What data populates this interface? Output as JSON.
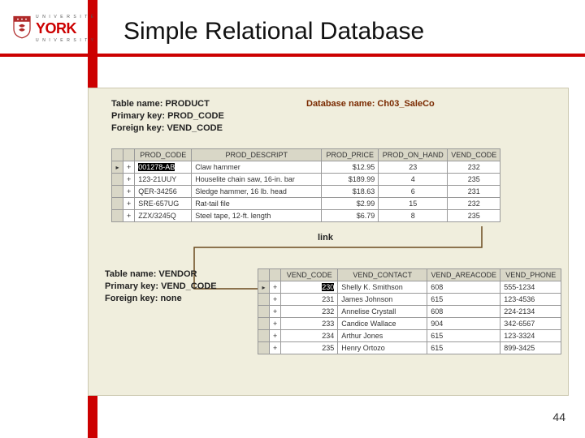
{
  "logo": {
    "universite": "U N I V E R S I T É",
    "york": "YORK",
    "university": "U N I V E R S I T Y"
  },
  "title": "Simple Relational Database",
  "figure": {
    "db_label": "Database name: Ch03_SaleCo",
    "product": {
      "meta": {
        "l1": "Table name: PRODUCT",
        "l2": "Primary key: PROD_CODE",
        "l3": "Foreign key: VEND_CODE"
      },
      "headers": {
        "c0": "PROD_CODE",
        "c1": "PROD_DESCRIPT",
        "c2": "PROD_PRICE",
        "c3": "PROD_ON_HAND",
        "c4": "VEND_CODE"
      },
      "rows": [
        {
          "code": "001278-AB",
          "desc": "Claw hammer",
          "price": "$12.95",
          "onhand": "23",
          "vend": "232"
        },
        {
          "code": "123-21UUY",
          "desc": "Houselite chain saw, 16-in. bar",
          "price": "$189.99",
          "onhand": "4",
          "vend": "235"
        },
        {
          "code": "QER-34256",
          "desc": "Sledge hammer, 16 lb. head",
          "price": "$18.63",
          "onhand": "6",
          "vend": "231"
        },
        {
          "code": "SRE-657UG",
          "desc": "Rat-tail file",
          "price": "$2.99",
          "onhand": "15",
          "vend": "232"
        },
        {
          "code": "ZZX/3245Q",
          "desc": "Steel tape, 12-ft. length",
          "price": "$6.79",
          "onhand": "8",
          "vend": "235"
        }
      ]
    },
    "link_label": "link",
    "vendor": {
      "meta": {
        "l1": "Table name: VENDOR",
        "l2": "Primary key: VEND_CODE",
        "l3": "Foreign key: none"
      },
      "headers": {
        "c0": "VEND_CODE",
        "c1": "VEND_CONTACT",
        "c2": "VEND_AREACODE",
        "c3": "VEND_PHONE"
      },
      "rows": [
        {
          "code": "230",
          "contact": "Shelly K. Smithson",
          "area": "608",
          "phone": "555-1234"
        },
        {
          "code": "231",
          "contact": "James Johnson",
          "area": "615",
          "phone": "123-4536"
        },
        {
          "code": "232",
          "contact": "Annelise Crystall",
          "area": "608",
          "phone": "224-2134"
        },
        {
          "code": "233",
          "contact": "Candice Wallace",
          "area": "904",
          "phone": "342-6567"
        },
        {
          "code": "234",
          "contact": "Arthur Jones",
          "area": "615",
          "phone": "123-3324"
        },
        {
          "code": "235",
          "contact": "Henry Ortozo",
          "area": "615",
          "phone": "899-3425"
        }
      ]
    }
  },
  "page_number": "44",
  "chart_data": {
    "type": "table",
    "database": "Ch03_SaleCo",
    "relationship": {
      "from": "PRODUCT.VEND_CODE",
      "to": "VENDOR.VEND_CODE",
      "label": "link"
    },
    "tables": [
      {
        "name": "PRODUCT",
        "primary_key": "PROD_CODE",
        "foreign_key": "VEND_CODE",
        "columns": [
          "PROD_CODE",
          "PROD_DESCRIPT",
          "PROD_PRICE",
          "PROD_ON_HAND",
          "VEND_CODE"
        ],
        "rows": [
          [
            "001278-AB",
            "Claw hammer",
            12.95,
            23,
            232
          ],
          [
            "123-21UUY",
            "Houselite chain saw, 16-in. bar",
            189.99,
            4,
            235
          ],
          [
            "QER-34256",
            "Sledge hammer, 16 lb. head",
            18.63,
            6,
            231
          ],
          [
            "SRE-657UG",
            "Rat-tail file",
            2.99,
            15,
            232
          ],
          [
            "ZZX/3245Q",
            "Steel tape, 12-ft. length",
            6.79,
            8,
            235
          ]
        ]
      },
      {
        "name": "VENDOR",
        "primary_key": "VEND_CODE",
        "foreign_key": null,
        "columns": [
          "VEND_CODE",
          "VEND_CONTACT",
          "VEND_AREACODE",
          "VEND_PHONE"
        ],
        "rows": [
          [
            230,
            "Shelly K. Smithson",
            608,
            "555-1234"
          ],
          [
            231,
            "James Johnson",
            615,
            "123-4536"
          ],
          [
            232,
            "Annelise Crystall",
            608,
            "224-2134"
          ],
          [
            233,
            "Candice Wallace",
            904,
            "342-6567"
          ],
          [
            234,
            "Arthur Jones",
            615,
            "123-3324"
          ],
          [
            235,
            "Henry Ortozo",
            615,
            "899-3425"
          ]
        ]
      }
    ]
  }
}
